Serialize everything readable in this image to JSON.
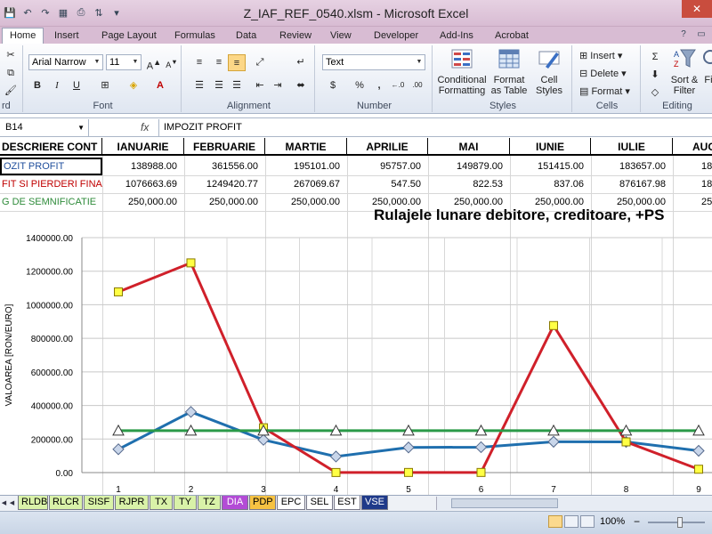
{
  "window": {
    "title": "Z_IAF_REF_0540.xlsm - Microsoft Excel",
    "close_glyph": "✕"
  },
  "quick_access": [
    "save-icon",
    "undo-icon",
    "redo-icon",
    "new-icon",
    "print-icon",
    "sort-icon"
  ],
  "ribbon_tabs": [
    "Home",
    "Insert",
    "Page Layout",
    "Formulas",
    "Data",
    "Review",
    "View",
    "Developer",
    "Add-Ins",
    "Acrobat"
  ],
  "active_tab": "Home",
  "ribbon": {
    "clipboard_label": "rd",
    "font": {
      "label": "Font",
      "name": "Arial Narrow",
      "size": "11",
      "bold": "B",
      "italic": "I",
      "underline": "U"
    },
    "alignment": {
      "label": "Alignment"
    },
    "number": {
      "label": "Number",
      "format": "Text",
      "currency": "$",
      "percent": "%",
      "comma": ",",
      "inc_decimals": "←.0",
      "dec_decimals": ".00"
    },
    "styles": {
      "label": "Styles",
      "conditional_formatting": "Conditional Formatting",
      "format_as_table": "Format as Table",
      "cell_styles": "Cell Styles"
    },
    "cells": {
      "label": "Cells",
      "insert": "Insert",
      "delete": "Delete",
      "format": "Format"
    },
    "editing": {
      "label": "Editing",
      "sort_filter": "Sort & Filter",
      "find": "Fi"
    }
  },
  "formula_bar": {
    "name_box": "B14",
    "fx": "fx",
    "content": "IMPOZIT PROFIT"
  },
  "table": {
    "headers": [
      "DESCRIERE CONT",
      "IANUARIE",
      "FEBRUARIE",
      "MARTIE",
      "APRILIE",
      "MAI",
      "IUNIE",
      "IULIE",
      "AUG"
    ],
    "rows": [
      {
        "label": "OZIT PROFIT",
        "color": "#1f4e9c",
        "values": [
          "138988.00",
          "361556.00",
          "195101.00",
          "95757.00",
          "149879.00",
          "151415.00",
          "183657.00",
          "18"
        ]
      },
      {
        "label": "FIT SI PIERDERI FINA",
        "color": "#c00000",
        "values": [
          "1076663.69",
          "1249420.77",
          "267069.67",
          "547.50",
          "822.53",
          "837.06",
          "876167.98",
          "18"
        ]
      },
      {
        "label": "G DE SEMNIFICATIE",
        "color": "#2e8b3a",
        "values": [
          "250,000.00",
          "250,000.00",
          "250,000.00",
          "250,000.00",
          "250,000.00",
          "250,000.00",
          "250,000.00",
          "25"
        ]
      }
    ]
  },
  "chart_data": {
    "type": "line",
    "title": "Rulajele lunare debitore, creditoare, +PS",
    "xlabel": "",
    "ylabel": "VALOAREA [RON/EURO]",
    "x": [
      1,
      2,
      3,
      4,
      5,
      6,
      7,
      8,
      9
    ],
    "ylim": [
      0,
      1400000
    ],
    "yticks": [
      "0.00",
      "200000.00",
      "400000.00",
      "600000.00",
      "800000.00",
      "1000000.00",
      "1200000.00",
      "1400000.00"
    ],
    "grid": true,
    "series": [
      {
        "color": "#1f6fae",
        "marker": "diamond",
        "values": [
          138988,
          361556,
          195101,
          95757,
          149879,
          151415,
          183657,
          183000,
          130000
        ]
      },
      {
        "color": "#d0202a",
        "marker": "square",
        "values": [
          1076663.69,
          1249420.77,
          267069.67,
          547.5,
          822.53,
          837.06,
          876167.98,
          183000,
          20000
        ]
      },
      {
        "color": "#2a9a48",
        "marker": "triangle",
        "values": [
          250000,
          250000,
          250000,
          250000,
          250000,
          250000,
          250000,
          250000,
          250000
        ]
      }
    ]
  },
  "sheet_tabs": [
    {
      "name": "RLDB",
      "color": "#d9f2a8"
    },
    {
      "name": "RLCR",
      "color": "#d9f2a8"
    },
    {
      "name": "SISF",
      "color": "#d9f2a8"
    },
    {
      "name": "RJPR",
      "color": "#d9f2a8"
    },
    {
      "name": "TX",
      "color": "#d9f2a8"
    },
    {
      "name": "TY",
      "color": "#d9f2a8"
    },
    {
      "name": "TZ",
      "color": "#d9f2a8"
    },
    {
      "name": "DIA",
      "color": "#b34bd6"
    },
    {
      "name": "PDP",
      "color": "#f6c242"
    },
    {
      "name": "EPC",
      "color": "#ffffff"
    },
    {
      "name": "SEL",
      "color": "#ffffff"
    },
    {
      "name": "EST",
      "color": "#ffffff"
    },
    {
      "name": "VSE",
      "color": "#1f3a8a"
    }
  ],
  "status": {
    "zoom": "100%",
    "zoom_minus": "−"
  }
}
